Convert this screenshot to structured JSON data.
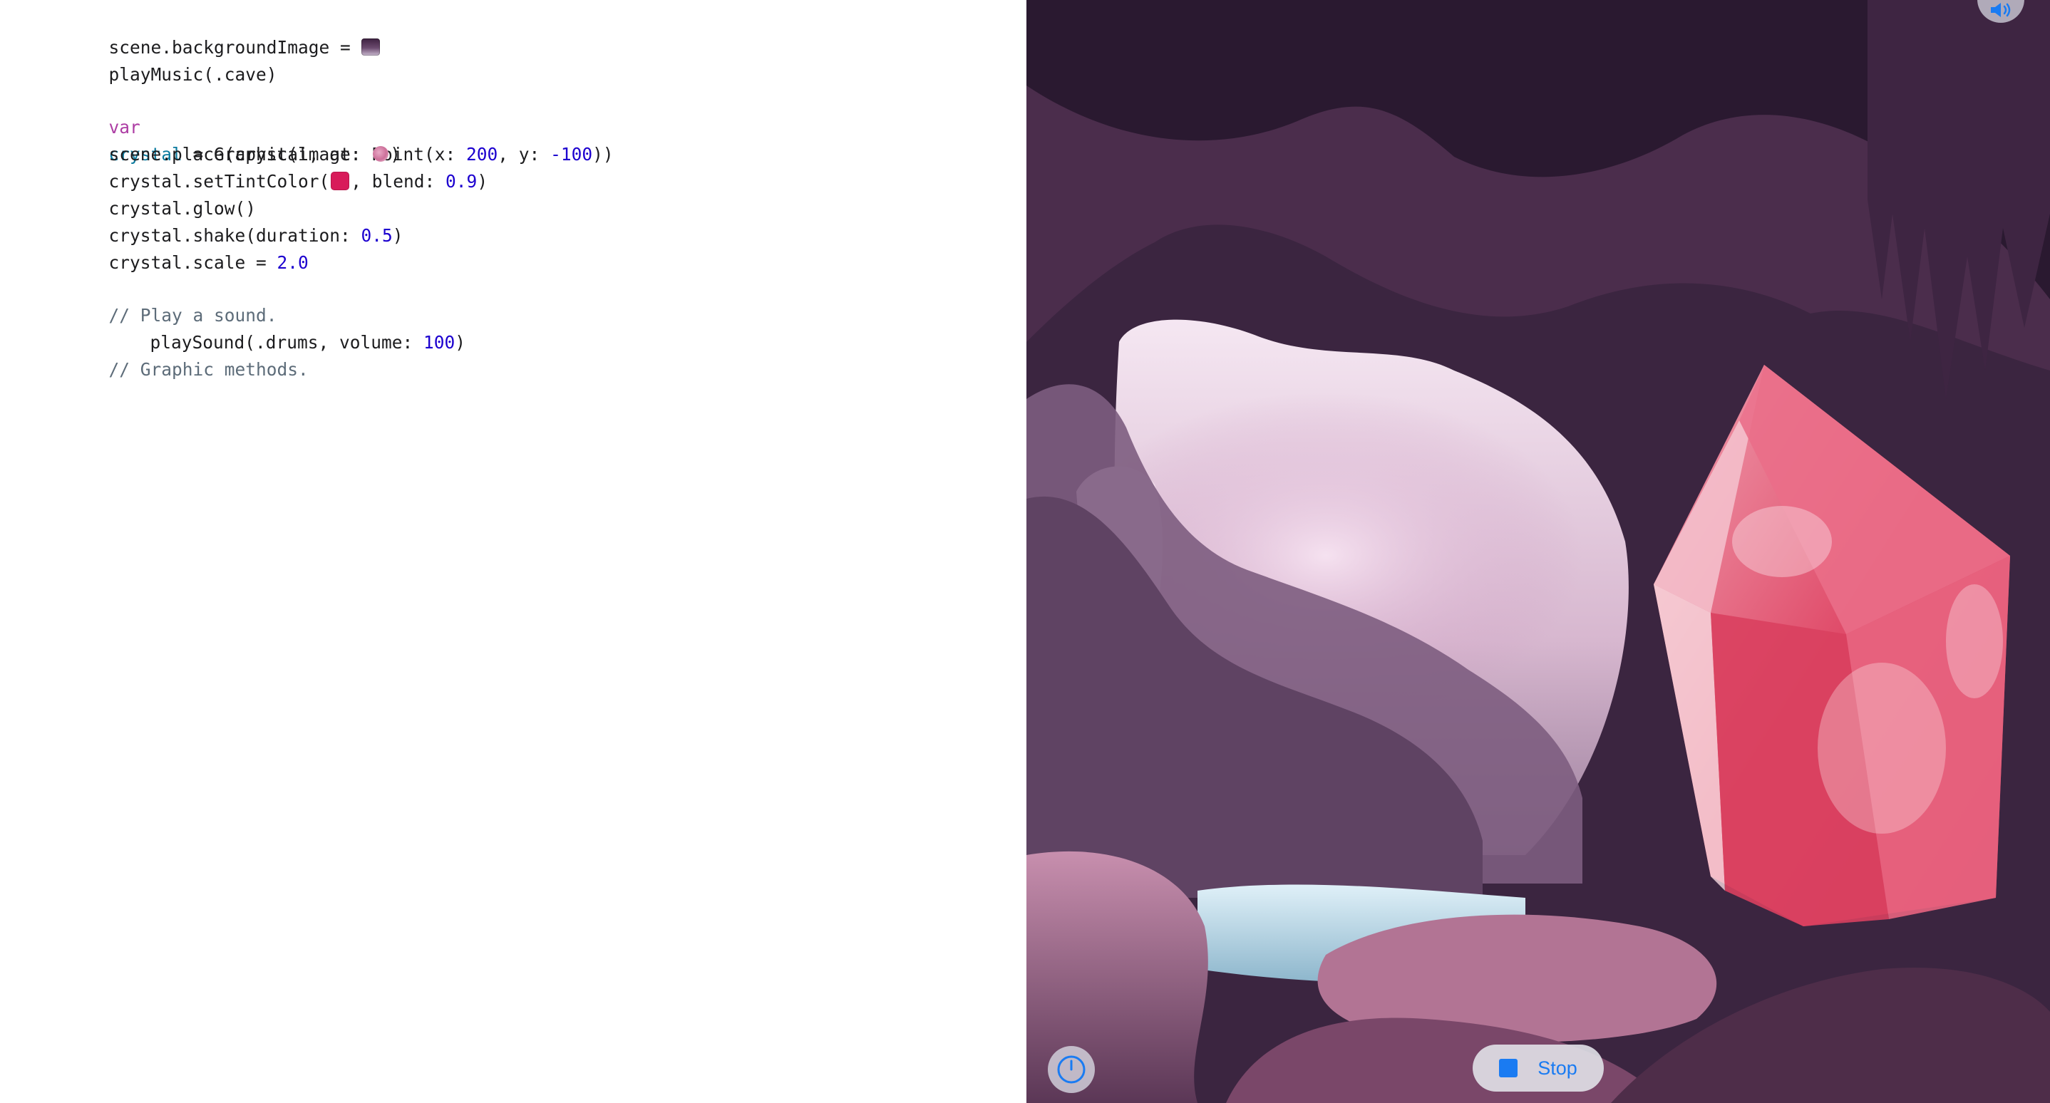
{
  "editor": {
    "line1": {
      "text": "scene.backgroundImage = ",
      "literal": "background-image-literal"
    },
    "line2": {
      "text": "playMusic(.cave)"
    },
    "line3": {
      "keyword": "var",
      "name": "crystal",
      "rest_a": " = Graphic(image: ",
      "literal": "crystal-image-literal",
      "rest_b": ")"
    },
    "line4": {
      "a": "scene.place(crystal, at: Point(x: ",
      "x": "200",
      "b": ", y: ",
      "y": "-100",
      "c": "))"
    },
    "line5": {
      "a": "crystal.setTintColor(",
      "color": "#d81b5a",
      "b": ", blend: ",
      "blend": "0.9",
      "c": ")"
    },
    "line6": {
      "text": "crystal.glow()"
    },
    "line7": {
      "a": "crystal.shake(duration: ",
      "duration": "0.5",
      "b": ")"
    },
    "line8": {
      "a": "crystal.scale = ",
      "scale": "2.0"
    },
    "line9": {
      "comment": "// Play a sound."
    },
    "line10": {
      "a": "playSound(.drums, volume: ",
      "volume": "100",
      "b": ")"
    },
    "line11": {
      "comment": "// Graphic methods."
    }
  },
  "liveview": {
    "audio_icon": "speaker-icon",
    "speed_icon": "speedometer-icon",
    "stop_label": "Stop",
    "accent_color": "#1a7bf2",
    "crystal_color": "#e0455f"
  }
}
